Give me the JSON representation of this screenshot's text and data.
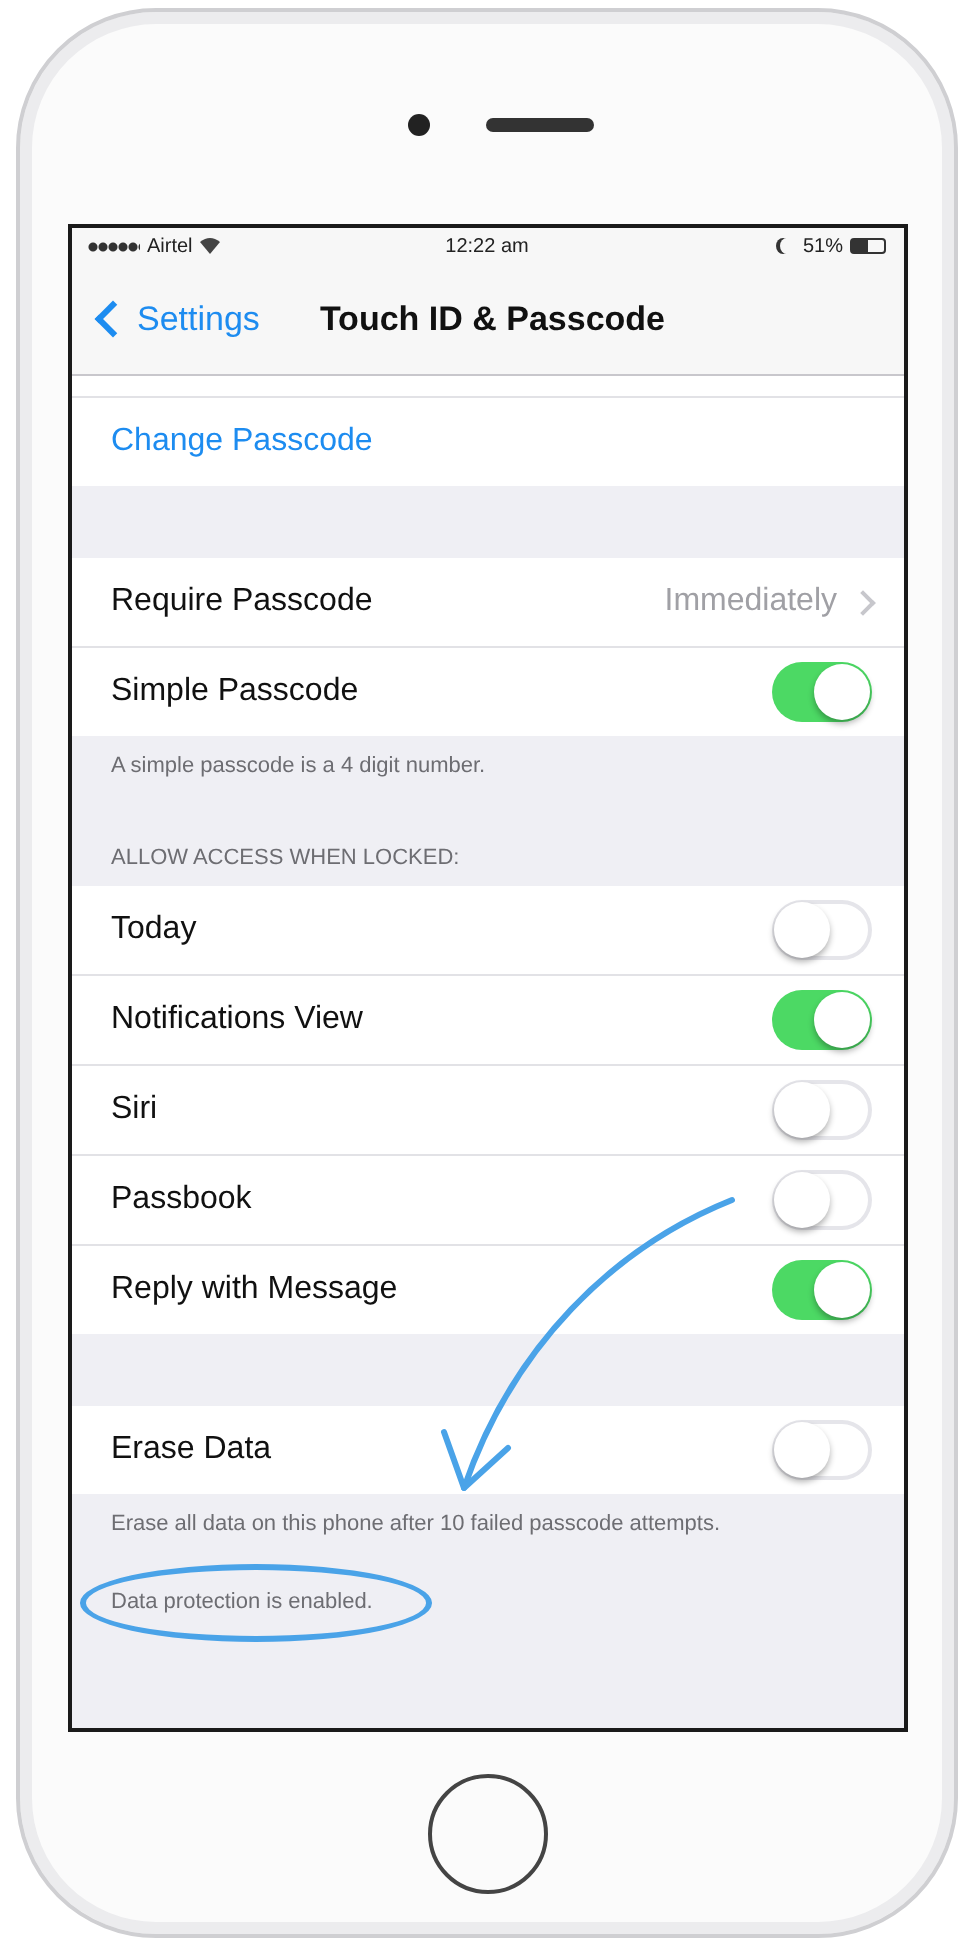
{
  "status_bar": {
    "carrier": "Airtel",
    "time": "12:22 am",
    "battery": "51%"
  },
  "nav": {
    "back": "Settings",
    "title": "Touch ID & Passcode"
  },
  "sections": [
    {
      "rows": [
        {
          "kind": "partial"
        },
        {
          "kind": "link",
          "label": "Change Passcode"
        }
      ]
    },
    {
      "rows": [
        {
          "kind": "detail",
          "label": "Require Passcode",
          "value": "Immediately"
        },
        {
          "kind": "toggle",
          "label": "Simple Passcode",
          "on": true
        }
      ],
      "footer": [
        "A simple passcode is a 4 digit number."
      ]
    },
    {
      "header": "ALLOW ACCESS WHEN LOCKED:",
      "rows": [
        {
          "kind": "toggle",
          "label": "Today",
          "on": false
        },
        {
          "kind": "toggle",
          "label": "Notifications View",
          "on": true
        },
        {
          "kind": "toggle",
          "label": "Siri",
          "on": false
        },
        {
          "kind": "toggle",
          "label": "Passbook",
          "on": false
        },
        {
          "kind": "toggle",
          "label": "Reply with Message",
          "on": true
        }
      ]
    },
    {
      "rows": [
        {
          "kind": "toggle",
          "label": "Erase Data",
          "on": false
        }
      ],
      "footer": [
        "Erase all data on this phone after 10 failed passcode attempts.",
        "Data protection is enabled."
      ]
    }
  ]
}
